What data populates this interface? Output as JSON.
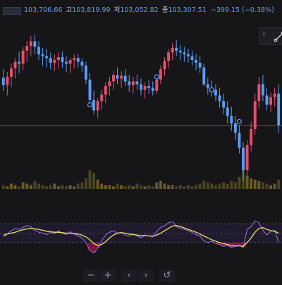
{
  "legend": {
    "open_label": "",
    "open": "103,706.66",
    "high_label": "고",
    "high": "103,819.99",
    "low_label": "저",
    "low": "103,052.82",
    "close_label": "종",
    "close": "103,307.51",
    "change": "−399.15 (−0.38%)"
  },
  "colors": {
    "background": "#161619",
    "up": "#e84e6a",
    "down": "#5b9cf6",
    "price_line": "#9a3344",
    "rsi_line": "#a070d8",
    "rsi_ma": "#e8e070",
    "rsi_band": "#1f1b2c",
    "volume_up": "#6b5a2a",
    "volume_down": "#4a4423"
  },
  "navbar": {
    "zoom_out": "−",
    "zoom_in": "+",
    "scroll_left": "‹",
    "scroll_right": "›",
    "reset": "↺"
  },
  "chart_data": {
    "type": "candlestick",
    "series": [
      {
        "name": "",
        "values": [
          [
            103370,
            103460,
            103230,
            103290
          ],
          [
            103290,
            103430,
            103180,
            103380
          ],
          [
            103380,
            103520,
            103270,
            103470
          ],
          [
            103470,
            103580,
            103360,
            103540
          ],
          [
            103540,
            103650,
            103420,
            103520
          ],
          [
            103520,
            103700,
            103450,
            103660
          ],
          [
            103660,
            103760,
            103540,
            103710
          ],
          [
            103710,
            103820,
            103600,
            103760
          ],
          [
            103760,
            103830,
            103620,
            103700
          ],
          [
            103700,
            103760,
            103560,
            103620
          ],
          [
            103620,
            103690,
            103500,
            103600
          ],
          [
            103600,
            103680,
            103480,
            103580
          ],
          [
            103580,
            103640,
            103460,
            103530
          ],
          [
            103530,
            103620,
            103440,
            103560
          ],
          [
            103560,
            103640,
            103470,
            103590
          ],
          [
            103590,
            103650,
            103480,
            103540
          ],
          [
            103540,
            103600,
            103430,
            103520
          ],
          [
            103520,
            103580,
            103420,
            103560
          ],
          [
            103560,
            103620,
            103470,
            103580
          ],
          [
            103580,
            103620,
            103480,
            103540
          ],
          [
            103540,
            103580,
            103430,
            103500
          ],
          [
            103500,
            103540,
            103300,
            103350
          ],
          [
            103350,
            103420,
            103080,
            103130
          ],
          [
            103130,
            103230,
            102980,
            103020
          ],
          [
            103020,
            103150,
            102940,
            103120
          ],
          [
            103120,
            103240,
            103030,
            103190
          ],
          [
            103190,
            103320,
            103100,
            103280
          ],
          [
            103280,
            103380,
            103180,
            103330
          ],
          [
            103330,
            103440,
            103240,
            103400
          ],
          [
            103400,
            103480,
            103300,
            103360
          ],
          [
            103360,
            103440,
            103260,
            103390
          ],
          [
            103390,
            103460,
            103280,
            103330
          ],
          [
            103330,
            103400,
            103220,
            103290
          ],
          [
            103290,
            103380,
            103200,
            103330
          ],
          [
            103330,
            103400,
            103240,
            103300
          ],
          [
            103300,
            103360,
            103180,
            103240
          ],
          [
            103240,
            103320,
            103150,
            103280
          ],
          [
            103280,
            103340,
            103200,
            103260
          ],
          [
            103260,
            103330,
            103180,
            103230
          ],
          [
            103230,
            103380,
            103200,
            103350
          ],
          [
            103350,
            103500,
            103300,
            103460
          ],
          [
            103460,
            103590,
            103390,
            103550
          ],
          [
            103550,
            103680,
            103470,
            103640
          ],
          [
            103640,
            103740,
            103560,
            103690
          ],
          [
            103690,
            103770,
            103600,
            103660
          ],
          [
            103660,
            103720,
            103560,
            103640
          ],
          [
            103640,
            103700,
            103540,
            103620
          ],
          [
            103620,
            103680,
            103530,
            103600
          ],
          [
            103600,
            103660,
            103500,
            103560
          ],
          [
            103560,
            103620,
            103450,
            103530
          ],
          [
            103530,
            103600,
            103420,
            103480
          ],
          [
            103480,
            103520,
            103280,
            103300
          ],
          [
            103300,
            103370,
            103190,
            103260
          ],
          [
            103260,
            103340,
            103170,
            103240
          ],
          [
            103240,
            103300,
            103120,
            103180
          ],
          [
            103180,
            103260,
            103050,
            103120
          ],
          [
            103120,
            103200,
            102980,
            103050
          ],
          [
            103050,
            103120,
            102880,
            102960
          ],
          [
            102960,
            103060,
            102800,
            102880
          ],
          [
            102880,
            102960,
            102700,
            102780
          ],
          [
            102780,
            102860,
            102560,
            102620
          ],
          [
            102620,
            102680,
            102260,
            102380
          ],
          [
            102380,
            102700,
            102320,
            102650
          ],
          [
            102650,
            102900,
            102580,
            102820
          ],
          [
            102820,
            103200,
            102760,
            103120
          ],
          [
            103120,
            103380,
            103040,
            103300
          ],
          [
            103300,
            103400,
            103120,
            103180
          ],
          [
            103180,
            103260,
            103020,
            103080
          ],
          [
            103080,
            103210,
            103000,
            103160
          ],
          [
            103160,
            103260,
            103060,
            103200
          ],
          [
            103200,
            103300,
            102780,
            102860
          ]
        ]
      }
    ],
    "rsi": [
      42,
      48,
      55,
      60,
      58,
      62,
      66,
      64,
      56,
      52,
      50,
      47,
      52,
      49,
      55,
      50,
      47,
      53,
      48,
      44,
      40,
      30,
      14,
      8,
      18,
      34,
      46,
      52,
      55,
      50,
      52,
      46,
      44,
      48,
      44,
      40,
      46,
      44,
      42,
      54,
      62,
      66,
      72,
      74,
      64,
      60,
      58,
      55,
      52,
      47,
      44,
      34,
      30,
      33,
      28,
      26,
      22,
      24,
      20,
      22,
      24,
      20,
      58,
      64,
      76,
      72,
      56,
      46,
      54,
      56,
      30
    ],
    "rsi_ma": [
      46,
      48,
      50,
      52,
      55,
      57,
      59,
      60,
      59,
      58,
      56,
      54,
      53,
      52,
      52,
      51,
      50,
      50,
      49,
      48,
      46,
      42,
      36,
      28,
      24,
      26,
      32,
      40,
      46,
      50,
      51,
      50,
      48,
      47,
      46,
      45,
      45,
      44,
      44,
      46,
      50,
      55,
      60,
      65,
      66,
      64,
      61,
      58,
      55,
      52,
      48,
      44,
      40,
      36,
      33,
      30,
      28,
      26,
      24,
      23,
      23,
      22,
      30,
      40,
      52,
      60,
      62,
      58,
      55,
      54,
      50
    ],
    "volume": [
      3,
      2,
      4,
      3,
      2,
      5,
      4,
      3,
      6,
      4,
      3,
      2,
      3,
      4,
      2,
      3,
      2,
      3,
      2,
      4,
      5,
      8,
      14,
      12,
      7,
      4,
      3,
      3,
      2,
      4,
      3,
      2,
      3,
      2,
      4,
      3,
      2,
      3,
      2,
      5,
      6,
      4,
      3,
      3,
      2,
      3,
      2,
      3,
      2,
      3,
      4,
      6,
      5,
      4,
      3,
      4,
      5,
      4,
      6,
      5,
      9,
      22,
      10,
      8,
      7,
      6,
      5,
      4,
      3,
      4,
      7
    ],
    "ylim": [
      102200,
      103900
    ],
    "rsi_ylim": [
      0,
      100
    ],
    "rsi_band": [
      30,
      70
    ],
    "markers": [
      {
        "index": 22,
        "price": 103080
      },
      {
        "index": 39,
        "price": 103380
      },
      {
        "index": 53,
        "price": 103240
      },
      {
        "index": 60,
        "price": 102900
      }
    ],
    "grid": false
  }
}
